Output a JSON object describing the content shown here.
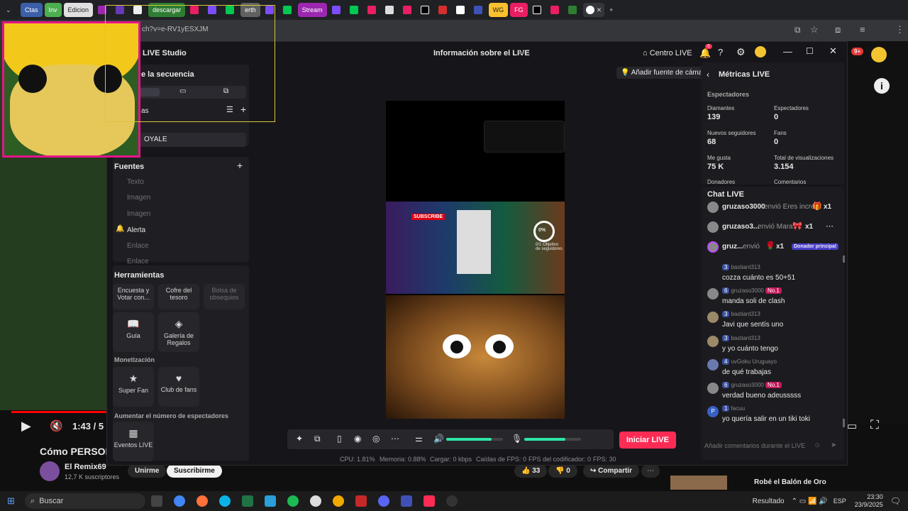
{
  "browser": {
    "tabs": [
      "Ctas",
      "Inv",
      "Edicion",
      "descargar",
      "erth",
      "Stream",
      "WG",
      "FG"
    ],
    "url": "ch?v=e-RV1yESXJM"
  },
  "studio": {
    "title": "LIVE Studio",
    "header_center": "Información sobre el LIVE",
    "centro_live": "Centro LIVE",
    "notif_count": "6",
    "add_camera": "Añadir fuente de cámara",
    "scene_section": "e la secuencia",
    "scenes_label": "as",
    "scene_item": "OYALE",
    "fuentes": "Fuentes",
    "sources": [
      "Texto",
      "Imagen",
      "Imagen",
      "Alerta",
      "Enlace",
      "Enlace"
    ],
    "herramientas": "Herramientas",
    "tools": [
      "Encuesta y Votar con...",
      "Cofre del tesoro",
      "Bolsa de obsequios",
      "Guía",
      "Galería de Regalos"
    ],
    "monetizacion": "Monetización",
    "monet_tools": [
      "Super Fan",
      "Club de fans"
    ],
    "aumentar": "Aumentar el número de espectadores",
    "eventos": "Eventos LIVE",
    "iniciar": "Iniciar LIVE",
    "stats": {
      "cpu": "CPU: 1.81%",
      "memoria": "Memoria: 0.88%",
      "cargar": "Cargar: 0 kbps",
      "caidas": "Caídas de FPS: 0",
      "fps_cod": "FPS del codificador: 0",
      "fps": "FPS: 30"
    },
    "preview_percent": "0%",
    "preview_goal": "0/1 Objetivo de seguidores",
    "preview_subscribe": "SUBSCRIBE"
  },
  "metrics": {
    "title": "Métricas LIVE",
    "section": "Espectadores",
    "items": [
      {
        "label": "Diamantes",
        "value": "139"
      },
      {
        "label": "Espectadores",
        "value": "0"
      },
      {
        "label": "Nuevos seguidores",
        "value": "68"
      },
      {
        "label": "Fans",
        "value": "0"
      },
      {
        "label": "Me gusta",
        "value": "75 K"
      },
      {
        "label": "Total de visualizaciones",
        "value": "3.154"
      }
    ],
    "cut_labels": [
      "Donadores",
      "Comentarios"
    ]
  },
  "chat": {
    "title": "Chat LIVE",
    "gifts": [
      {
        "user": "gruzaso3000",
        "text": "envió Eres incre",
        "count": "x1"
      },
      {
        "user": "gruzaso3...",
        "text": "envió Mara",
        "count": "x1"
      },
      {
        "user": "gruz...",
        "text": "envió",
        "count": "x1",
        "badge": "Donador principal"
      }
    ],
    "messages": [
      {
        "badge": "3",
        "user": "bastiant313",
        "text": "cozza cuánto es 50+51"
      },
      {
        "badge": "6",
        "user": "gruzaso3000",
        "rank": "No.1",
        "text": "manda soli de clash"
      },
      {
        "badge": "3",
        "user": "bastiant313",
        "text": "Javi que sentís uno"
      },
      {
        "badge": "3",
        "user": "bastiant313",
        "text": "y yo cuánto tengo"
      },
      {
        "badge": "4",
        "user": "uvGoku Uruguayo",
        "text": "de qué trabajas"
      },
      {
        "badge": "6",
        "user": "gruzaso3000",
        "rank": "No.1",
        "text": "verdad bueno adeusssss"
      },
      {
        "badge": "1",
        "user": "facuu",
        "text": "yo quería salir en un tiki toki"
      }
    ],
    "placeholder": "Añadir comentarios durante el LIVE"
  },
  "youtube": {
    "time": "1:43 / 5",
    "title": "Cómo PERSON",
    "channel": "El Remix69",
    "subs": "12,7 K suscriptores",
    "join": "Unirme",
    "subscribe": "Suscribirme",
    "likes": "33",
    "dislikes": "0",
    "share": "Compartir",
    "side_title": "Robé el Balón de Oro",
    "badge_count": "9+"
  },
  "taskbar": {
    "search": "Buscar",
    "result": "Resultado",
    "lang": "ESP",
    "time": "23:30",
    "date": "23/9/2025"
  }
}
